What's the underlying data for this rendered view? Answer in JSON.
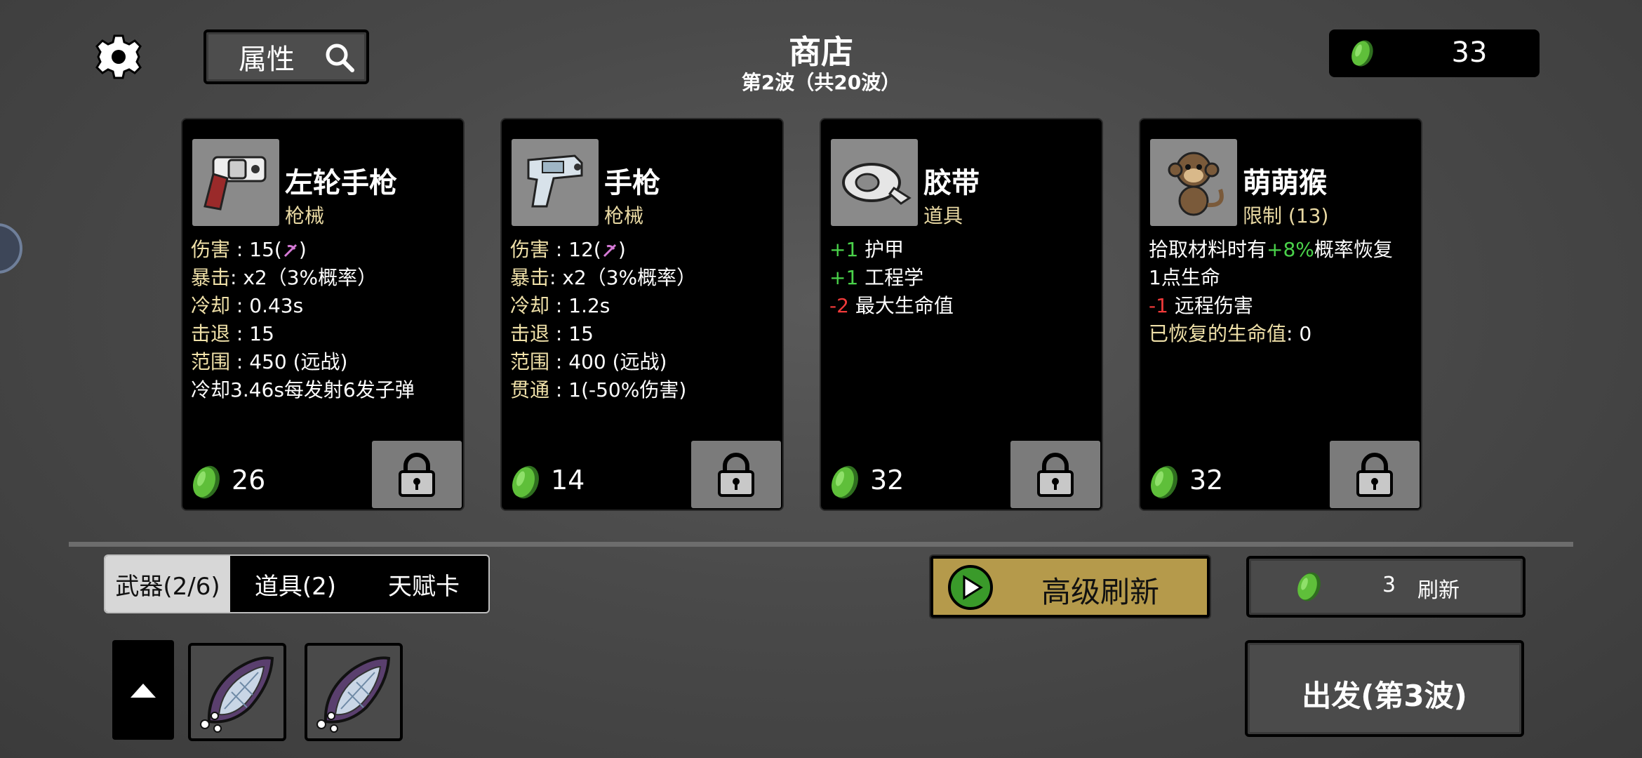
{
  "header": {
    "title": "商店",
    "wave": "第2波（共20波）",
    "attributes_label": "属性",
    "materials": "33"
  },
  "cards": [
    {
      "name": "左轮手枪",
      "type": "枪械",
      "icon": "revolver-icon",
      "stats": [
        {
          "key": "伤害",
          "sep": " : ",
          "value": "15(",
          "tail": ")",
          "has_icon": true
        },
        {
          "key": "暴击",
          "sep": ":  ",
          "value": "x2（3%概率）"
        },
        {
          "key": "冷却",
          "sep": " : ",
          "value": "0.43s"
        },
        {
          "key": "击退",
          "sep": " : ",
          "value": "15"
        },
        {
          "key": "范围",
          "sep": " : ",
          "value": "450 (远战)"
        },
        {
          "plain": "冷却3.46s每发射6发子弹"
        }
      ],
      "price": "26"
    },
    {
      "name": "手枪",
      "type": "枪械",
      "icon": "pistol-icon",
      "stats": [
        {
          "key": "伤害",
          "sep": " : ",
          "value": "12(",
          "tail": ")",
          "has_icon": true
        },
        {
          "key": "暴击",
          "sep": ":  ",
          "value": "x2（3%概率）"
        },
        {
          "key": "冷却",
          "sep": " : ",
          "value": "1.2s"
        },
        {
          "key": "击退",
          "sep": " : ",
          "value": "15"
        },
        {
          "key": "范围",
          "sep": " : ",
          "value": "400 (远战)"
        },
        {
          "key": "贯通",
          "sep": " : ",
          "value": "1(-50%伤害)"
        }
      ],
      "price": "14"
    },
    {
      "name": "胶带",
      "type": "道具",
      "icon": "tape-icon",
      "stats": [
        {
          "mod": "+1",
          "mod_class": "pos",
          "text": " 护甲"
        },
        {
          "mod": "+1",
          "mod_class": "pos",
          "text": " 工程学"
        },
        {
          "mod": "-2",
          "mod_class": "neg",
          "text": " 最大生命值"
        }
      ],
      "price": "32"
    },
    {
      "name": "萌萌猴",
      "type": "限制 (13)",
      "icon": "monkey-icon",
      "stats": [
        {
          "pre": "拾取材料时有",
          "mod": "+8%",
          "mod_class": "pos",
          "text": "概率恢复"
        },
        {
          "plain": "1点生命"
        },
        {
          "mod": "-1",
          "mod_class": "neg",
          "text": " 远程伤害"
        },
        {
          "key": "已恢复的生命值",
          "sep": ":  ",
          "value": "0"
        }
      ],
      "price": "32"
    }
  ],
  "tabs": [
    {
      "label": "武器(2/6)",
      "active": true
    },
    {
      "label": "道具(2)",
      "active": false
    },
    {
      "label": "天赋卡",
      "active": false
    }
  ],
  "buttons": {
    "advanced_refresh": "高级刷新",
    "refresh_cost": "3",
    "refresh_label": "刷新",
    "start": "出发(第3波)"
  },
  "inventory": [
    "crystal-weapon-icon",
    "crystal-weapon-icon"
  ],
  "colors": {
    "positive": "#4ad24a",
    "negative": "#f03a3a",
    "stat_key": "#efe0a8",
    "coin": "#5fbf3a",
    "gold_button": "#b59a4b"
  }
}
